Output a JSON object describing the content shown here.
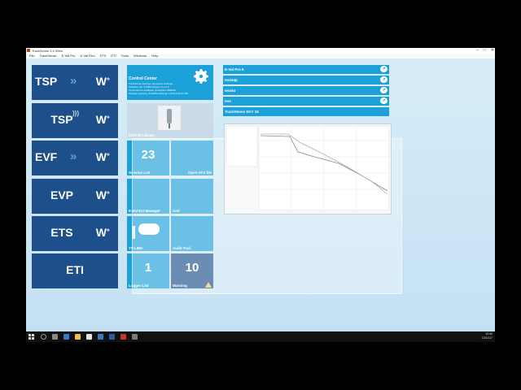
{
  "window": {
    "title": "TrackSense 5.0 Wins"
  },
  "menubar": {
    "items": [
      "File",
      "TrackSense",
      "E-Val Pro",
      "E-Val Flex",
      "ETS",
      "ETI",
      "Tools",
      "Windows",
      "Help"
    ]
  },
  "left_tiles": [
    {
      "label": "TSP",
      "arrows": "»",
      "w": "W"
    },
    {
      "label": "TSP",
      "w": "W"
    },
    {
      "label": "EVF",
      "arrows": "»",
      "w": "W"
    },
    {
      "label": "EVP",
      "w": "W"
    },
    {
      "label": "ETS",
      "w": "W"
    },
    {
      "label": "ETI"
    }
  ],
  "control_center": {
    "title": "Control Center",
    "info_lines": [
      "TrackSense Settings: European Settings",
      "Software Ver. 5.0000  Version: 5.1.0.0",
      "Connected to database: [local] ELLAB/Ellab",
      "Storage Capacity (Total/Remaining): 19/20 (9.0/10 GB)"
    ]
  },
  "tiles": {
    "pro_library": "PRO-ID Library",
    "session_count": "23",
    "session_list": "Session List",
    "open_ats": "Open ATS file",
    "eval_manager": "E-Val Ext Manager",
    "unit": "Unit",
    "tv_link": "TV-LINK",
    "audit_trail": "Audit Trail",
    "logger_count": "1",
    "logger_list": "Logger List",
    "warning_count": "10",
    "warning": "Warning"
  },
  "right_list": [
    "E-Val Pro 6",
    "test44p",
    "test44",
    "test",
    "TrackSense SKY 15"
  ],
  "taskbar": {
    "time": "12:00",
    "date": "13/11/17"
  }
}
